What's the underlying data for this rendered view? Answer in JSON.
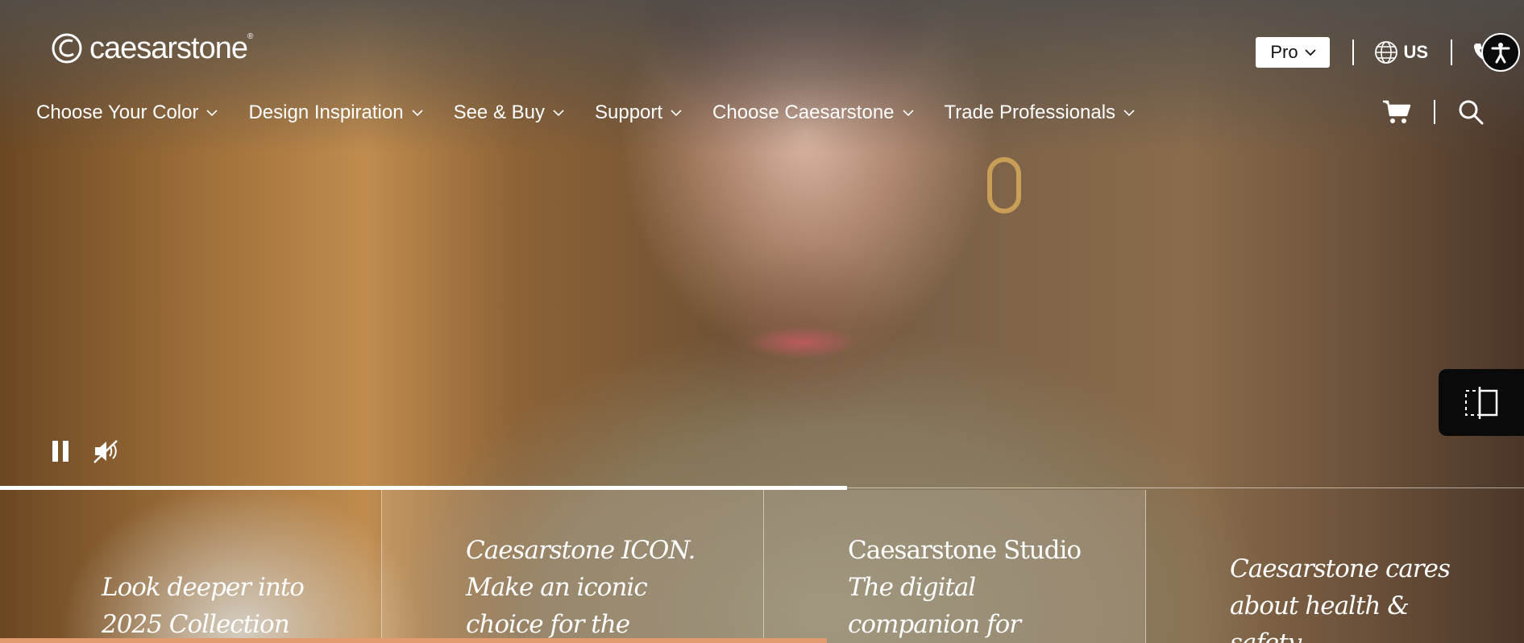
{
  "brand": {
    "name": "caesarstone",
    "registered": "®"
  },
  "utility": {
    "pro_label": "Pro",
    "region_label": "US"
  },
  "nav": {
    "items": [
      {
        "label": "Choose Your Color"
      },
      {
        "label": "Design Inspiration"
      },
      {
        "label": "See & Buy"
      },
      {
        "label": "Support"
      },
      {
        "label": "Choose Caesarstone"
      },
      {
        "label": "Trade Professionals"
      }
    ]
  },
  "video": {
    "progress": 0.556,
    "state": "playing",
    "muted": true
  },
  "slides": [
    {
      "lines": [
        "Look deeper into",
        "2025 Collection"
      ]
    },
    {
      "lines": [
        "Caesarstone ICON.",
        "Make an iconic",
        "choice for the"
      ]
    },
    {
      "lines": [
        "Caesarstone Studio",
        "The digital",
        "companion for"
      ]
    },
    {
      "lines": [
        "Caesarstone cares",
        "about health &",
        "safety"
      ]
    }
  ],
  "colors": {
    "accent_bar": "#e09a6c",
    "overlay_dark": "#0a0a0a",
    "text": "#ffffff"
  }
}
